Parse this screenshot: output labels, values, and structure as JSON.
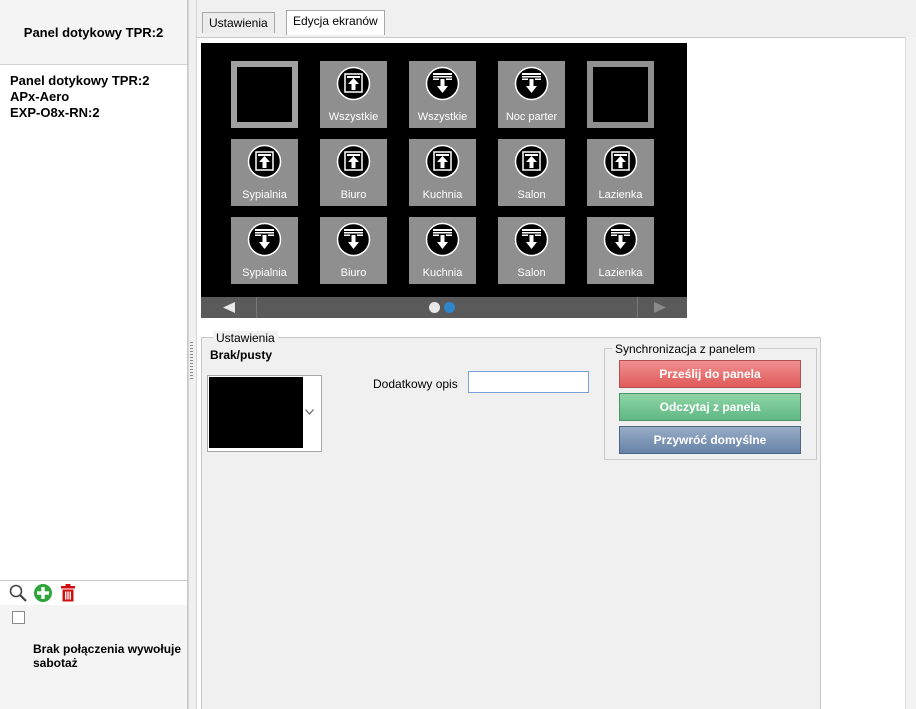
{
  "left": {
    "header": "Panel dotykowy TPR:2",
    "tree": [
      "Panel dotykowy TPR:2",
      "APx-Aero",
      "EXP-O8x-RN:2"
    ],
    "toolbar_icons": [
      "search-icon",
      "add-icon",
      "delete-icon"
    ],
    "tamper_checked": false,
    "tamper_label": "Brak połączenia wywołuje sabotaż"
  },
  "tabs": [
    {
      "label": "Ustawienia",
      "active": false
    },
    {
      "label": "Edycja ekranów",
      "active": true
    }
  ],
  "screen": {
    "tiles": [
      {
        "label": "",
        "icon": "blank",
        "selected": true
      },
      {
        "label": "Wszystkie",
        "icon": "blind-up-icon"
      },
      {
        "label": "Wszystkie",
        "icon": "blind-down-icon"
      },
      {
        "label": "Noc parter",
        "icon": "blind-down-icon"
      },
      {
        "label": "",
        "icon": "blank"
      },
      {
        "label": "Sypialnia",
        "icon": "blind-up-icon"
      },
      {
        "label": "Biuro",
        "icon": "blind-up-icon"
      },
      {
        "label": "Kuchnia",
        "icon": "blind-up-icon"
      },
      {
        "label": "Salon",
        "icon": "blind-up-icon"
      },
      {
        "label": "Lazienka",
        "icon": "blind-up-icon"
      },
      {
        "label": "Sypialnia",
        "icon": "blind-down-icon"
      },
      {
        "label": "Biuro",
        "icon": "blind-down-icon"
      },
      {
        "label": "Kuchnia",
        "icon": "blind-down-icon"
      },
      {
        "label": "Salon",
        "icon": "blind-down-icon"
      },
      {
        "label": "Lazienka",
        "icon": "blind-down-icon"
      }
    ],
    "page_count": 2,
    "current_page": 2
  },
  "settings": {
    "legend": "Ustawienia",
    "item_name": "Brak/pusty",
    "extra_label": "Dodatkowy opis",
    "extra_value": ""
  },
  "sync": {
    "legend": "Synchronizacja z panelem",
    "send": "Prześlij do panela",
    "read": "Odczytaj z panela",
    "restore": "Przywróć domyślne"
  }
}
